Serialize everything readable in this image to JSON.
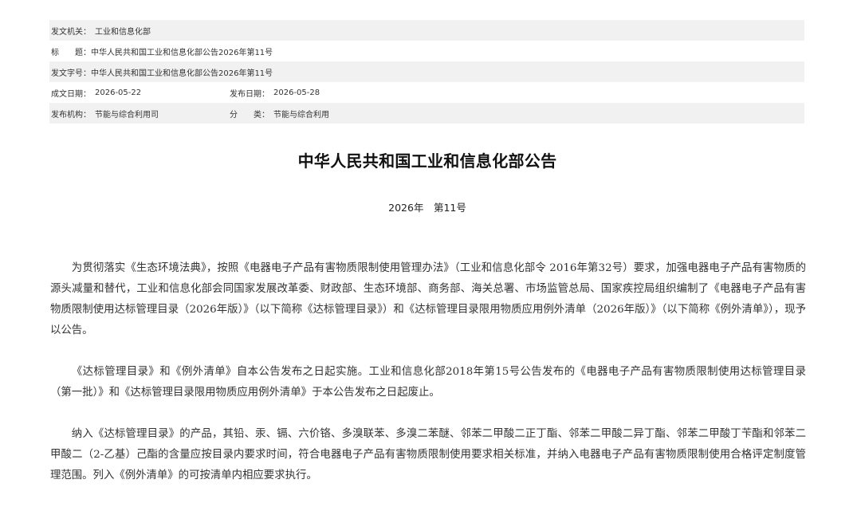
{
  "meta": {
    "issuer": {
      "label": "发文机关：",
      "value": "工业和信息化部"
    },
    "title": {
      "label": "标　　题：",
      "value": "中华人民共和国工业和信息化部公告2026年第11号"
    },
    "doc_no": {
      "label": "发文字号：",
      "value": "中华人民共和国工业和信息化部公告2026年第11号"
    },
    "created_date": {
      "label": "成文日期：",
      "value": "2026-05-22"
    },
    "published_date": {
      "label": "发布日期：",
      "value": "2026-05-28"
    },
    "publisher": {
      "label": "发布机构：",
      "value": "节能与综合利用司"
    },
    "category": {
      "label": "分　　类：",
      "value": "节能与综合利用"
    }
  },
  "document": {
    "heading": "中华人民共和国工业和信息化部公告",
    "number": "2026年　第11号",
    "paragraphs": [
      "为贯彻落实《生态环境法典》，按照《电器电子产品有害物质限制使用管理办法》（工业和信息化部令 2016年第32号）要求，加强电器电子产品有害物质的源头减量和替代，工业和信息化部会同国家发展改革委、财政部、生态环境部、商务部、海关总署、市场监管总局、国家疾控局组织编制了《电器电子产品有害物质限制使用达标管理目录（2026年版）》（以下简称《达标管理目录》）和《达标管理目录限用物质应用例外清单（2026年版）》（以下简称《例外清单》），现予以公告。",
      "《达标管理目录》和《例外清单》自本公告发布之日起实施。工业和信息化部2018年第15号公告发布的《电器电子产品有害物质限制使用达标管理目录（第一批）》和《达标管理目录限用物质应用例外清单》于本公告发布之日起废止。",
      "纳入《达标管理目录》的产品，其铅、汞、镉、六价铬、多溴联苯、多溴二苯醚、邻苯二甲酸二正丁酯、邻苯二甲酸二异丁酯、邻苯二甲酸丁苄酯和邻苯二甲酸二（2-乙基）己酯的含量应按目录内要求时间，符合电器电子产品有害物质限制使用要求相关标准，并纳入电器电子产品有害物质限制使用合格评定制度管理范围。列入《例外清单》的可按清单内相应要求执行。"
    ]
  }
}
